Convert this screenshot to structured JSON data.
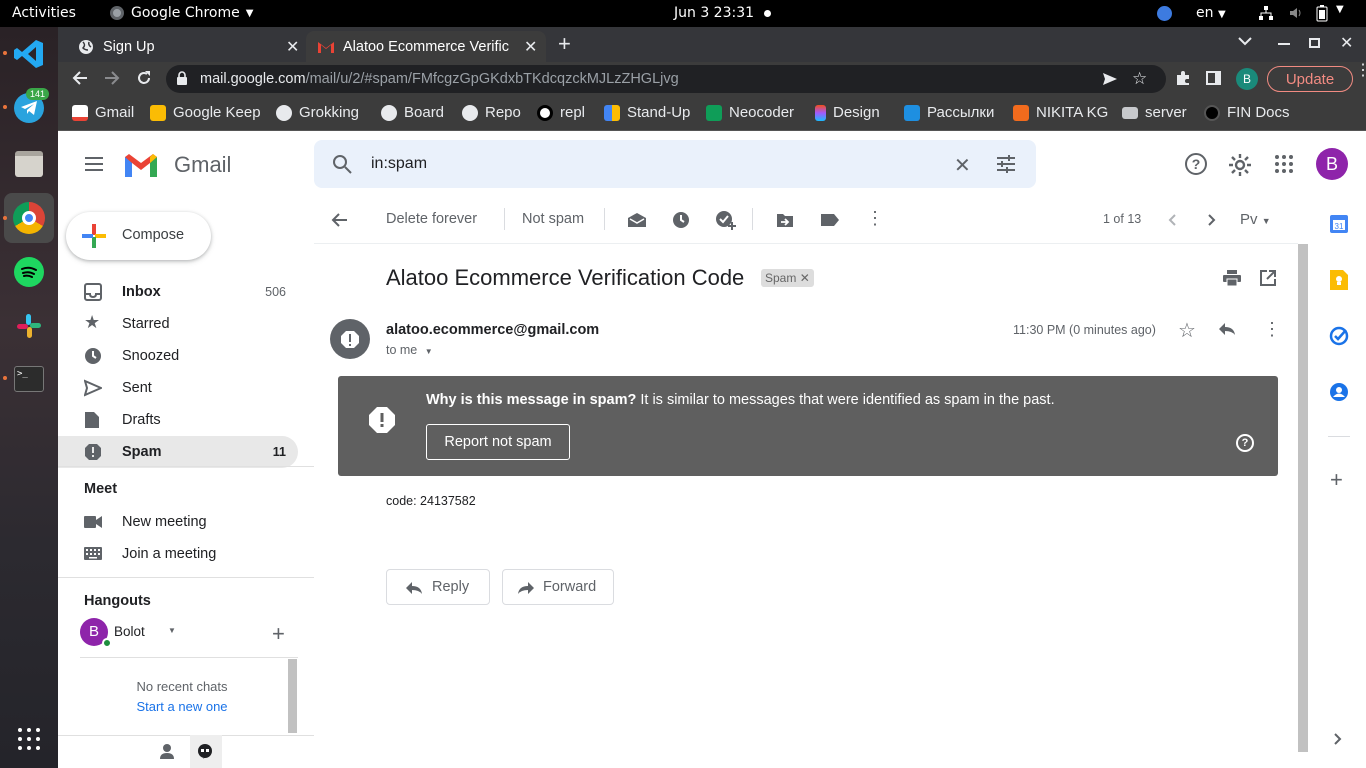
{
  "topbar": {
    "activities": "Activities",
    "app": "Google Chrome",
    "clock": "Jun 3  23:31",
    "lang": "en"
  },
  "dock": {
    "telegram_badge": "141"
  },
  "tabs": [
    {
      "title": "Sign Up"
    },
    {
      "title": "Alatoo Ecommerce Verific"
    }
  ],
  "omnibox": {
    "url_host": "mail.google.com",
    "url_path": "/mail/u/2/#spam/FMfcgzGpGKdxbTKdcqzckMJLzZHGLjvg",
    "update": "Update",
    "profile": "B"
  },
  "bookmarks": [
    "Gmail",
    "Google Keep",
    "Grokking",
    "Board",
    "Repo",
    "repl",
    "Stand-Up",
    "Neocoder",
    "Design",
    "Рассылки",
    "NIKITA KG",
    "server",
    "FIN Docs"
  ],
  "gmail": {
    "logo": "Gmail",
    "search": "in:spam",
    "avatar": "B",
    "compose": "Compose",
    "nav": [
      {
        "label": "Inbox",
        "count": "506"
      },
      {
        "label": "Starred",
        "count": ""
      },
      {
        "label": "Snoozed",
        "count": ""
      },
      {
        "label": "Sent",
        "count": ""
      },
      {
        "label": "Drafts",
        "count": ""
      },
      {
        "label": "Spam",
        "count": "11"
      }
    ],
    "meet": {
      "title": "Meet",
      "new": "New meeting",
      "join": "Join a meeting"
    },
    "hangouts": {
      "title": "Hangouts",
      "user": "Bolot",
      "avatar": "B",
      "empty": "No recent chats",
      "start": "Start a new one"
    },
    "toolbar": {
      "delete": "Delete forever",
      "notspam": "Not spam",
      "pager": "1 of 13",
      "lang": "Рv"
    },
    "message": {
      "subject": "Alatoo Ecommerce Verification Code",
      "label": "Spam",
      "sender": "alatoo.ecommerce@gmail.com",
      "to": "to me",
      "time": "11:30 PM (0 minutes ago)",
      "warning_bold": "Why is this message in spam?",
      "warning_text": " It is similar to messages that were identified as spam in the past.",
      "report": "Report not spam",
      "body": "code: 24137582",
      "reply": "Reply",
      "forward": "Forward"
    }
  }
}
